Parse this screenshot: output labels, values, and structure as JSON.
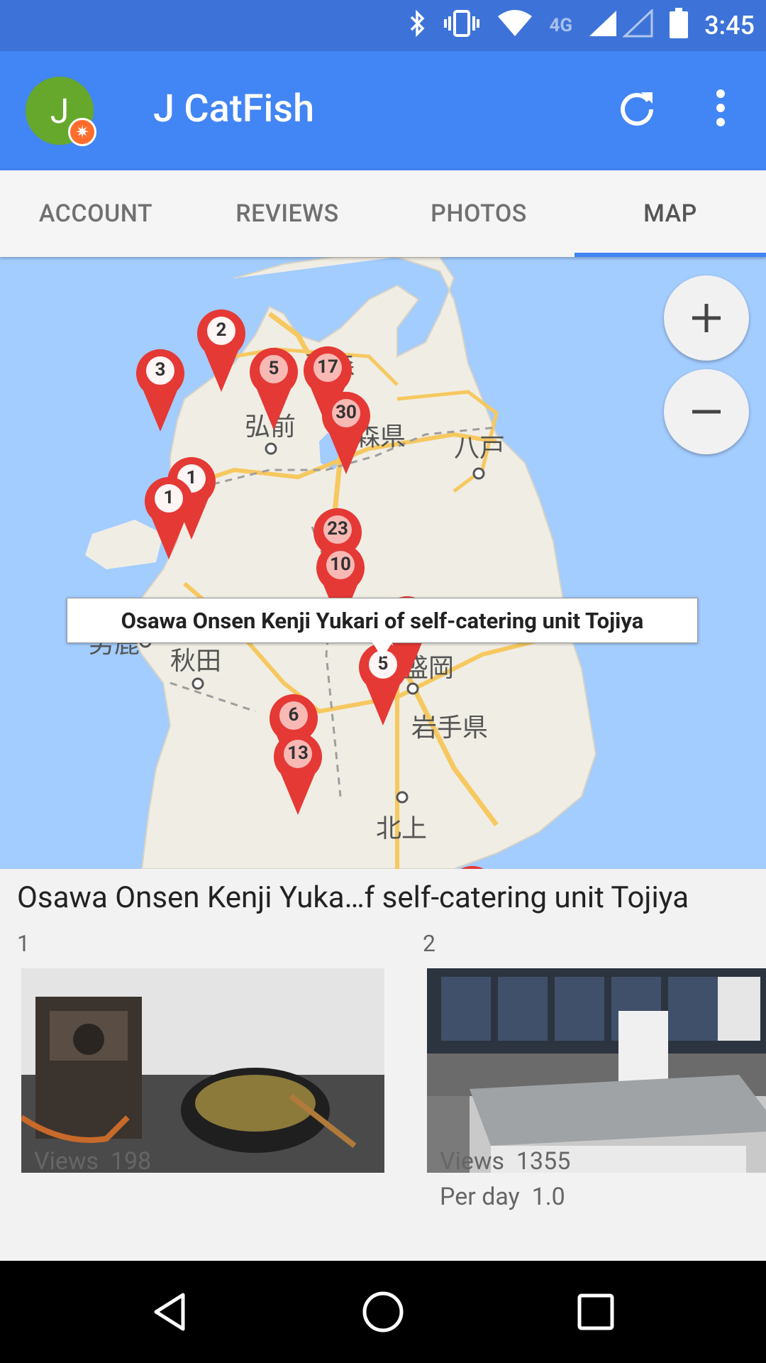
{
  "status_bar": {
    "time": "3:45",
    "network": "4G",
    "icons": [
      "bluetooth-icon",
      "vibrate-icon",
      "wifi-icon",
      "signal-icon",
      "battery-icon"
    ]
  },
  "app_bar": {
    "avatar_letter": "J",
    "title": "J CatFish",
    "actions": [
      "refresh-icon",
      "more-vert-icon"
    ]
  },
  "tabs": [
    {
      "label": "ACCOUNT",
      "active": false
    },
    {
      "label": "REVIEWS",
      "active": false
    },
    {
      "label": "PHOTOS",
      "active": false
    },
    {
      "label": "MAP",
      "active": true
    }
  ],
  "map": {
    "zoom_in": "+",
    "zoom_out": "−",
    "info_window": "Osawa Onsen Kenji Yukari of self-catering unit Tojiya",
    "labels": [
      "青森",
      "弘前",
      "森県",
      "八戸",
      "秋田",
      "男鹿",
      "盛岡",
      "岩手県",
      "北上"
    ],
    "markers": [
      "2",
      "3",
      "5",
      "17",
      "30",
      "1",
      "1",
      "23",
      "10",
      "5",
      "6",
      "13"
    ]
  },
  "place": {
    "title": "Osawa Onsen Kenji Yuka…f self-catering unit Tojiya"
  },
  "photos": [
    {
      "index": "1",
      "views_label": "Views",
      "views": "198"
    },
    {
      "index": "2",
      "views_label": "Views",
      "views": "1355",
      "per_day_label": "Per day",
      "per_day": "1.0"
    }
  ],
  "colors": {
    "status_bar": "#3d73d8",
    "app_bar": "#4285f4",
    "tab_indicator": "#4285f4",
    "pin": "#e53935",
    "water": "#a3ccff",
    "land": "#f0ede4"
  }
}
